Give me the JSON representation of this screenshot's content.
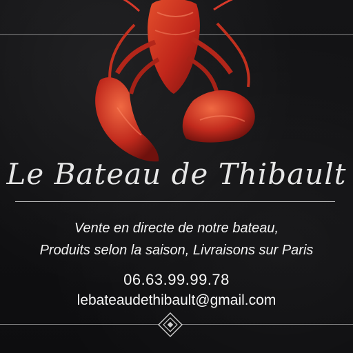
{
  "card": {
    "title": "Le Bateau de Thibault",
    "tagline_line1": "Vente en directe de notre bateau,",
    "tagline_line2": "Produits selon la saison, Livraisons sur Paris",
    "phone": "06.63.99.99.78",
    "email": "lebateaudethibault@gmail.com"
  },
  "image": {
    "subject": "red-lobster",
    "background": "black-card",
    "accent_color": "#c1271b"
  }
}
